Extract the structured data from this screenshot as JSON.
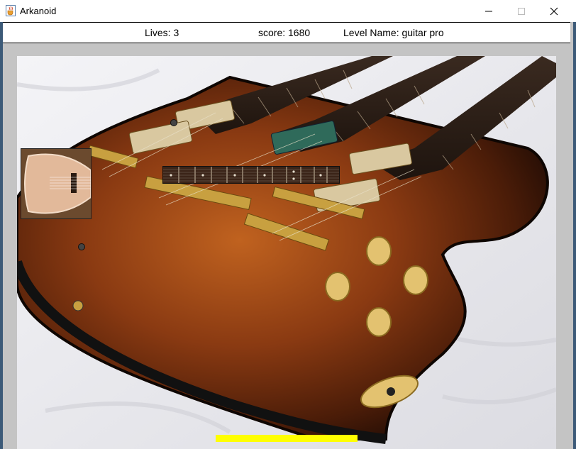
{
  "window": {
    "title": "Arkanoid",
    "app_icon": "java-cup-icon",
    "minimize_icon": "minimize-icon",
    "maximize_icon": "maximize-icon",
    "close_icon": "close-icon"
  },
  "hud": {
    "lives_text": "Lives: 3",
    "score_text": "score: 1680",
    "level_text": "Level Name: guitar pro"
  },
  "game": {
    "background_image": "double-neck-electric-guitar",
    "blocks": [
      {
        "kind": "acoustic-guitar-body-block"
      },
      {
        "kind": "fretboard-block"
      }
    ],
    "balls": [
      {
        "id": 1
      },
      {
        "id": 2
      }
    ],
    "paddle_color": "#ffff00",
    "frame_color": "#c4c4c4"
  }
}
